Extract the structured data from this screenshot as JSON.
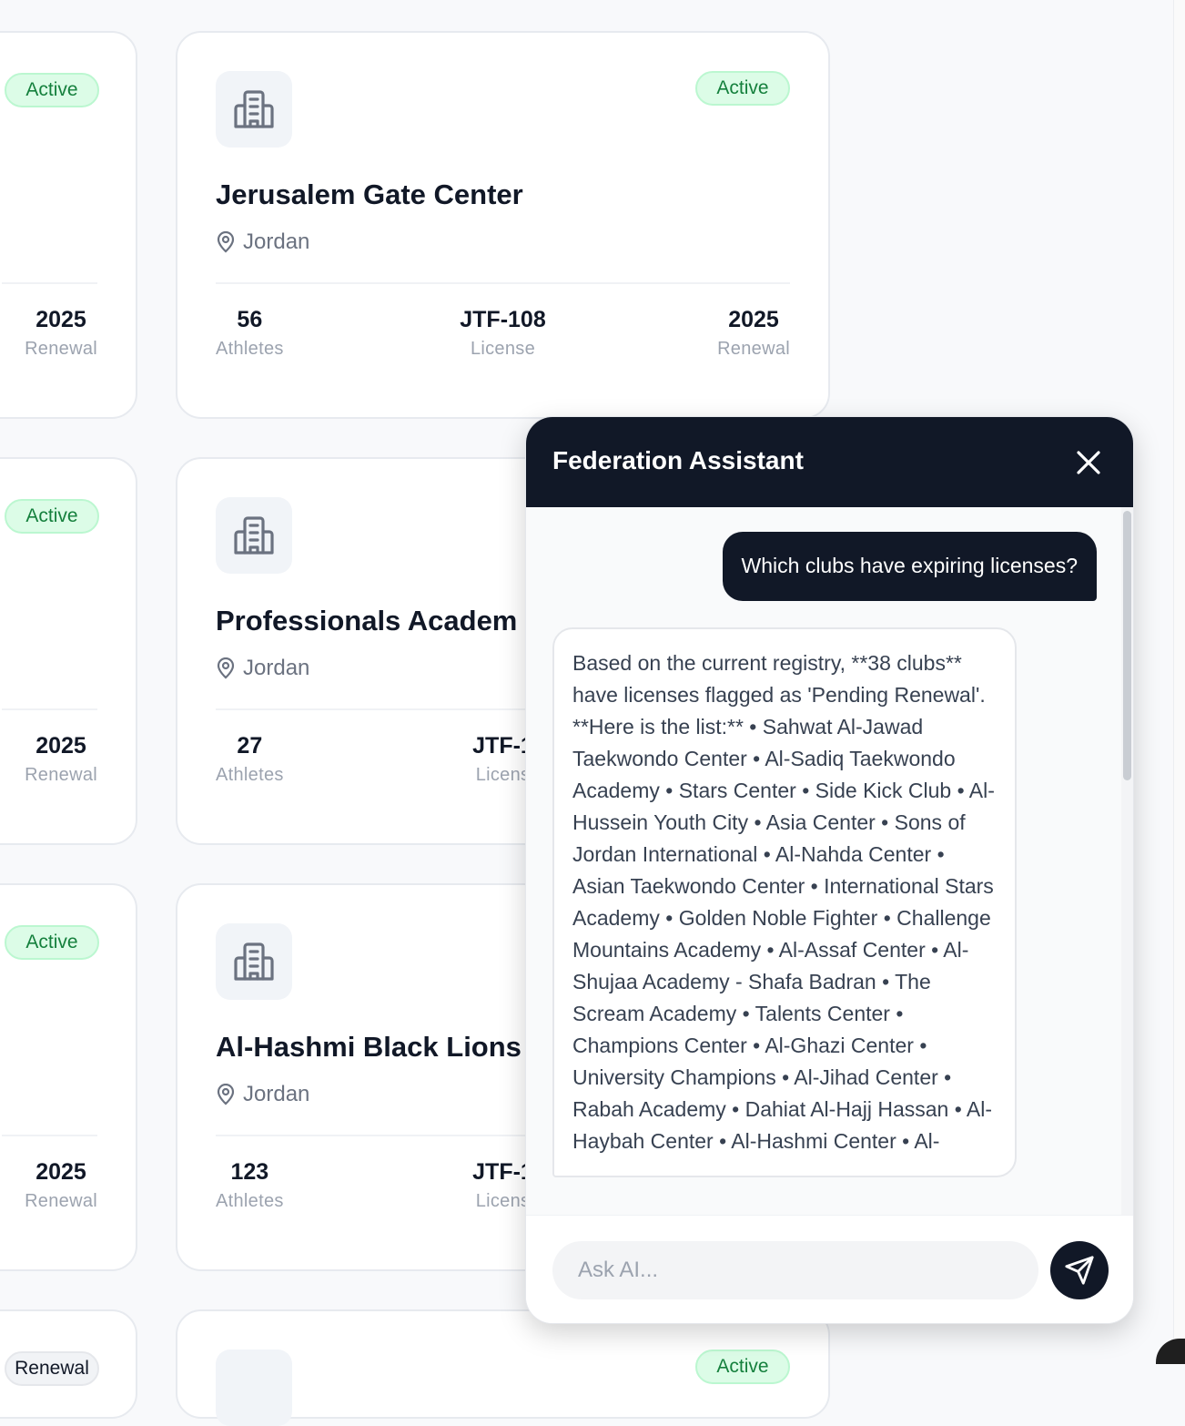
{
  "clubs": [
    {
      "row": 1,
      "left": {
        "status": "Active",
        "renewal_value": "2025",
        "renewal_label": "Renewal"
      },
      "right": {
        "status": "Active",
        "name": "Jerusalem Gate Center",
        "location": "Jordan",
        "athletes_value": "56",
        "athletes_label": "Athletes",
        "license_value": "JTF-108",
        "license_label": "License",
        "renewal_value": "2025",
        "renewal_label": "Renewal"
      }
    },
    {
      "row": 2,
      "left": {
        "status": "Active",
        "renewal_value": "2025",
        "renewal_label": "Renewal"
      },
      "right": {
        "name": "Professionals Academ",
        "location": "Jordan",
        "athletes_value": "27",
        "athletes_label": "Athletes",
        "license_value": "JTF-1",
        "license_label": "Licens"
      }
    },
    {
      "row": 3,
      "left": {
        "status": "Active",
        "renewal_value": "2025",
        "renewal_label": "Renewal"
      },
      "right": {
        "name": "Al-Hashmi Black Lions",
        "location": "Jordan",
        "athletes_value": "123",
        "athletes_label": "Athletes",
        "license_value": "JTF-1",
        "license_label": "Licens"
      }
    },
    {
      "row": 4,
      "left": {
        "status": "Renewal"
      },
      "right": {
        "status": "Active"
      }
    }
  ],
  "chat": {
    "title": "Federation Assistant",
    "user_message": "Which clubs have expiring licenses?",
    "ai_message": "Based on the current registry, **38 clubs** have licenses flagged as 'Pending Renewal'. **Here is the list:** • Sahwat Al-Jawad Taekwondo Center • Al-Sadiq Taekwondo Academy • Stars Center • Side Kick Club • Al-Hussein Youth City • Asia Center • Sons of Jordan International • Al-Nahda Center • Asian Taekwondo Center • International Stars Academy • Golden Noble Fighter • Challenge Mountains Academy • Al-Assaf Center • Al-Shujaa Academy - Shafa Badran • The Scream Academy • Talents Center • Champions Center • Al-Ghazi Center • University Champions • Al-Jihad Center • Rabah Academy • Dahiat Al-Hajj Hassan • Al-Haybah Center • Al-Hashmi Center • Al-",
    "input_placeholder": "Ask AI...",
    "input_value": ""
  },
  "icons": {
    "club": "building-icon",
    "location": "map-pin-icon",
    "close": "close-icon",
    "send": "send-icon"
  },
  "colors": {
    "header_bg": "#111827",
    "badge_bg": "#dcfce7",
    "badge_text": "#15803d"
  }
}
